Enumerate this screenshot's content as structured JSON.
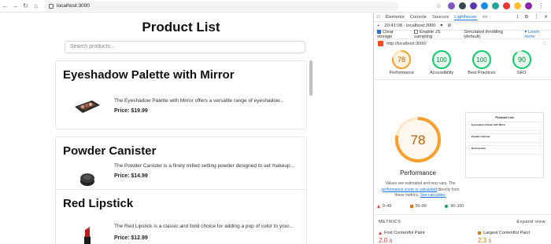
{
  "browser": {
    "url": "localhost:3000"
  },
  "page": {
    "title": "Product List",
    "search_placeholder": "Search products...",
    "products": [
      {
        "name": "Eyeshadow Palette with Mirror",
        "description": "The Eyeshadow Palette with Mirror offers a versatile range of eyeshadow...",
        "price": "Price: $19.99"
      },
      {
        "name": "Powder Canister",
        "description": "The Powder Canister is a finely milled setting powder designed to set makeup...",
        "price": "Price: $14.99"
      },
      {
        "name": "Red Lipstick",
        "description": "The Red Lipstick is a classic and bold choice for adding a pop of color to your...",
        "price": "Price: $12.99"
      }
    ]
  },
  "devtools": {
    "tabs": [
      "Elements",
      "Console",
      "Sources",
      "Lighthouse"
    ],
    "active_tab": "Lighthouse",
    "more_tabs": ">>",
    "issues_count": "1",
    "report_label": "20:41:08 - localhost:3000",
    "options": {
      "clear_storage": "Clear storage",
      "js_sampling": "Enable JS sampling",
      "throttling": "Simulated throttling (default)",
      "learn_more": "Learn more"
    },
    "report_url": "http://localhost:3000/",
    "scores": [
      {
        "label": "Performance",
        "value": 78,
        "color": "#fa9e2e"
      },
      {
        "label": "Accessibility",
        "value": 100,
        "color": "#0cce6b"
      },
      {
        "label": "Best Practices",
        "value": 100,
        "color": "#0cce6b"
      },
      {
        "label": "SEO",
        "value": 90,
        "color": "#0cce6b"
      }
    ],
    "main_gauge": {
      "label": "Performance",
      "value": 78
    },
    "note": {
      "line1": "Values are estimated and may vary. The",
      "link1": "performance score is calculated",
      "line2": "directly from these metrics.",
      "link2": "See calculator."
    },
    "legend": [
      "0–49",
      "50–89",
      "90–100"
    ],
    "mini_shot": {
      "title": "Product List",
      "cards": [
        "Eyeshadow Palette with Mirror",
        "Powder Canister",
        "Red Lipstick"
      ]
    },
    "metrics": {
      "header": "METRICS",
      "expand": "Expand view",
      "items": [
        {
          "label": "First Contentful Paint",
          "value": "2.0 s"
        },
        {
          "label": "Largest Contentful Paint",
          "value": "2.3 s"
        }
      ]
    }
  },
  "colors": {
    "accent": "#1a73e8",
    "orange": "#fa9e2e",
    "green": "#0cce6b"
  }
}
